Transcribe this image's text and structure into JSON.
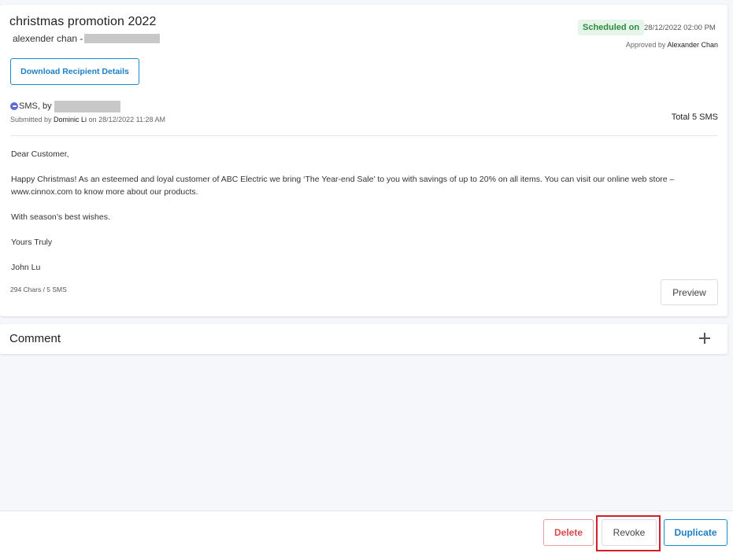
{
  "campaign": {
    "title": "christmas promotion 2022",
    "sender": "alexender chan -",
    "status_badge": "Scheduled on",
    "scheduled_time": "28/12/2022 02:00 PM",
    "approved_prefix": "Approved by",
    "approved_by": "Alexander Chan"
  },
  "download_button_label": "Download Recipient Details",
  "channel": {
    "icon": "sms-icon",
    "label": "SMS, by",
    "submitted_prefix": "Submitted by",
    "submitted_by": "Dominic Li",
    "submitted_on": "on 28/12/2022 11:28 AM",
    "total": "Total 5 SMS"
  },
  "message": {
    "paragraphs": [
      "Dear Customer,",
      "Happy Christmas! As an esteemed and loyal customer of ABC Electric we bring ‘The Year-end Sale’ to you with savings of up to 20% on all items. You can visit our online web store – www.cinnox.com to know more about our products.",
      "With season’s best wishes.",
      "Yours Truly",
      "John Lu"
    ],
    "char_count": "294 Chars / 5 SMS",
    "preview_label": "Preview"
  },
  "comment": {
    "title": "Comment",
    "add_icon": "plus-icon"
  },
  "footer": {
    "delete_label": "Delete",
    "revoke_label": "Revoke",
    "duplicate_label": "Duplicate"
  },
  "colors": {
    "accent": "#1d8fd1",
    "badge_bg": "#e6f5e9",
    "badge_text": "#2e8a3e",
    "delete": "#d94a4a",
    "highlight": "#d0202a"
  }
}
